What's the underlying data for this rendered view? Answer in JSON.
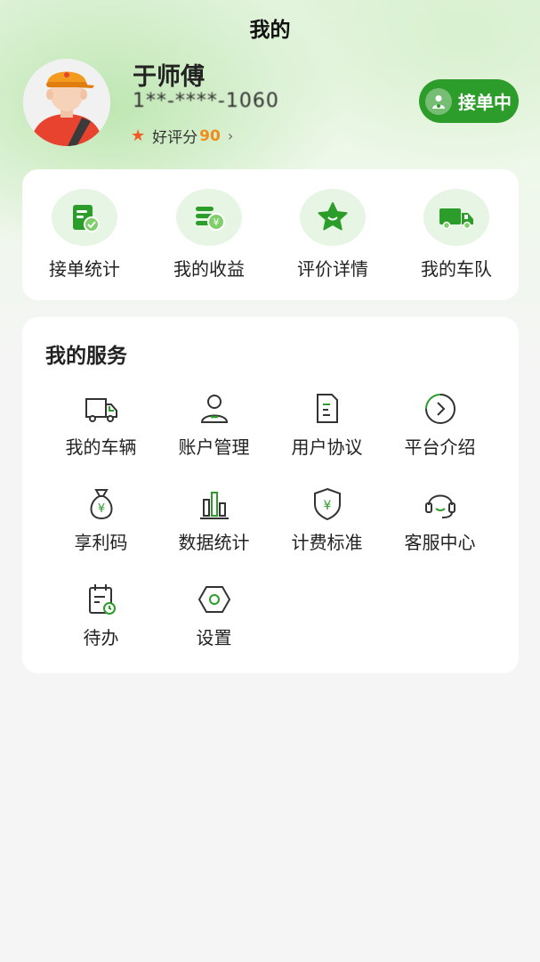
{
  "header": {
    "title": "我的"
  },
  "profile": {
    "name": "于师傅",
    "phone": "1**-****-1060",
    "rating_label": "好评分",
    "rating_value": "90",
    "status_label": "接单中"
  },
  "quick_actions": [
    {
      "label": "接单统计",
      "icon": "order-stats-icon"
    },
    {
      "label": "我的收益",
      "icon": "earnings-icon"
    },
    {
      "label": "评价详情",
      "icon": "star-icon"
    },
    {
      "label": "我的车队",
      "icon": "truck-icon"
    }
  ],
  "services": {
    "title": "我的服务",
    "items": [
      {
        "label": "我的车辆",
        "icon": "vehicle-icon"
      },
      {
        "label": "账户管理",
        "icon": "user-icon"
      },
      {
        "label": "用户协议",
        "icon": "document-icon"
      },
      {
        "label": "平台介绍",
        "icon": "arrow-circle-icon"
      },
      {
        "label": "享利码",
        "icon": "money-bag-icon"
      },
      {
        "label": "数据统计",
        "icon": "bar-chart-icon"
      },
      {
        "label": "计费标准",
        "icon": "shield-yen-icon"
      },
      {
        "label": "客服中心",
        "icon": "headset-icon"
      },
      {
        "label": "待办",
        "icon": "calendar-clock-icon"
      },
      {
        "label": "设置",
        "icon": "settings-icon"
      }
    ]
  },
  "colors": {
    "accent": "#2c9c2a",
    "rating_score": "#f08c1a",
    "rating_star": "#f05a24",
    "page_bg": "#f5f5f5"
  }
}
